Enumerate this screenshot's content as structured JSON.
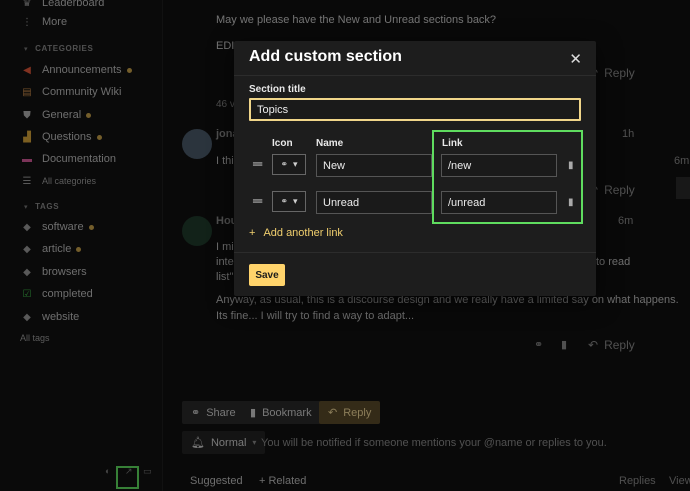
{
  "sidebar": {
    "top_items": [
      {
        "label": "Leaderboard",
        "icon": "trophy-icon"
      },
      {
        "label": "More",
        "icon": "more-icon"
      }
    ],
    "categories_header": "CATEGORIES",
    "categories": [
      {
        "label": "Announcements",
        "icon": "megaphone-icon",
        "dot": true
      },
      {
        "label": "Community Wiki",
        "icon": "book-icon",
        "dot": false
      },
      {
        "label": "General",
        "icon": "shield-icon",
        "dot": true
      },
      {
        "label": "Questions",
        "icon": "chart-icon",
        "dot": true
      },
      {
        "label": "Documentation",
        "icon": "doc-icon",
        "dot": false
      }
    ],
    "all_categories": "All categories",
    "tags_header": "TAGS",
    "tags": [
      {
        "label": "software",
        "icon": "tag-icon",
        "dot": true
      },
      {
        "label": "article",
        "icon": "tag-icon",
        "dot": true
      },
      {
        "label": "browsers",
        "icon": "tag-icon",
        "dot": false
      },
      {
        "label": "completed",
        "icon": "check-icon",
        "dot": false
      },
      {
        "label": "website",
        "icon": "tag-icon",
        "dot": false
      }
    ],
    "all_tags": "All tags"
  },
  "topic": {
    "line1": "May we please have the New and Unread sections back?",
    "line2": "EDIT",
    "reply": "Reply",
    "views_partial": "46 v",
    "user1": "jona",
    "time1": "1h",
    "text1": "I thi",
    "user2": "Hou",
    "time2": "6m",
    "text2a": "I mi",
    "text2b": "inte",
    "text2c": "list\"",
    "text2d": "to read",
    "text2e": "Anyway, as usual, this is a discourse design and we really have a limited say on what happens.",
    "text2f": "Its fine... I will try to find a way to adapt...",
    "timeline_time": "6m"
  },
  "actions": {
    "share": "Share",
    "bookmark": "Bookmark",
    "reply": "Reply",
    "notify_level": "Normal",
    "notify_text": "You will be notified if someone mentions your @name or replies to you."
  },
  "bottom_tabs": {
    "suggested": "Suggested",
    "related": "Related",
    "col_replies": "Replies",
    "col_views": "View"
  },
  "modal": {
    "title": "Add custom section",
    "section_title_label": "Section title",
    "section_title_value": "Topics",
    "col_icon": "Icon",
    "col_name": "Name",
    "col_link": "Link",
    "rows": [
      {
        "icon": "link-icon",
        "name": "New",
        "link": "/new"
      },
      {
        "icon": "link-icon",
        "name": "Unread",
        "link": "/unread"
      }
    ],
    "add_another": "Add another link",
    "save": "Save"
  },
  "colors": {
    "accent": "#ffd36b",
    "highlight_box": "#5fdc5f",
    "background": "#111111",
    "modal_bg": "#1d1d1d"
  }
}
